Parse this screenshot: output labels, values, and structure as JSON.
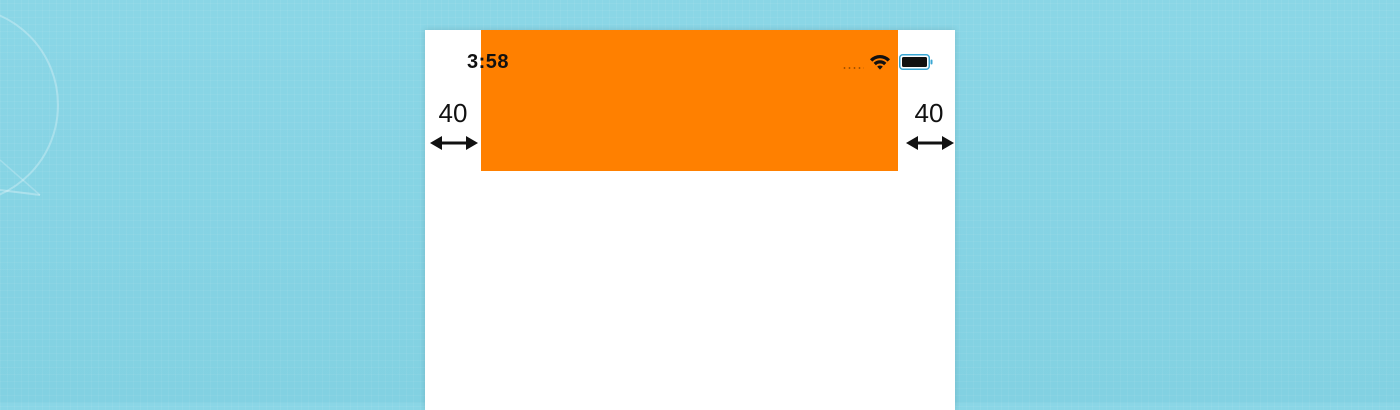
{
  "status_bar": {
    "time": "3:58"
  },
  "margins": {
    "left_value": "40",
    "right_value": "40"
  },
  "icons": {
    "wifi": "wifi-icon",
    "battery": "battery-icon",
    "signal": "signal-dots-icon",
    "arrow": "double-headed-arrow-icon"
  },
  "colors": {
    "background": "#86d3e3",
    "orange_view": "#ff8000",
    "screen": "#ffffff",
    "text": "#111111",
    "battery_outline": "#3aa7d4"
  }
}
